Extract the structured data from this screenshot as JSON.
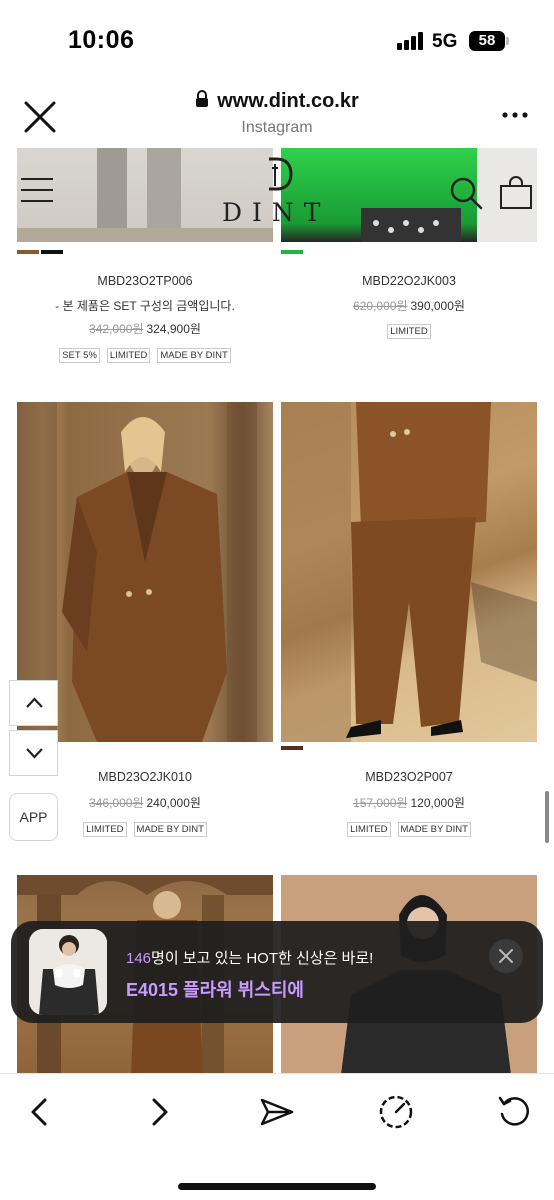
{
  "status_bar": {
    "time": "10:06",
    "network": "5G",
    "battery": "58"
  },
  "browser": {
    "url": "www.dint.co.kr",
    "source": "Instagram"
  },
  "site": {
    "logo": "DINT"
  },
  "products": [
    {
      "code": "MBD23O2TP006",
      "note": "- 본 제품은 SET 구성의 금액입니다.",
      "old_price": "342,000원",
      "price": "324,900원",
      "tags": [
        "SET 5%",
        "LIMITED",
        "MADE BY DINT"
      ],
      "swatches": [
        "#8a5a34",
        "#111111"
      ]
    },
    {
      "code": "MBD22O2JK003",
      "old_price": "620,000원",
      "price": "390,000원",
      "tags": [
        "LIMITED"
      ],
      "swatches": [
        "#1fb53e"
      ]
    },
    {
      "code": "MBD23O2JK010",
      "old_price": "346,000원",
      "price": "240,000원",
      "tags": [
        "LIMITED",
        "MADE BY DINT"
      ],
      "swatches": []
    },
    {
      "code": "MBD23O2P007",
      "old_price": "157,000원",
      "price": "120,000원",
      "tags": [
        "LIMITED",
        "MADE BY DINT"
      ],
      "swatches": [
        "#5a2e1e"
      ]
    }
  ],
  "floating": {
    "app_label": "APP"
  },
  "notification": {
    "count": "146",
    "message_rest": "명이 보고 있는 HOT한 신상은 바로!",
    "product": "E4015 플라워 뷔스티에"
  },
  "colors": {
    "accent_purple": "#c79bff",
    "toast_bg": "#1e1e1e"
  },
  "icons": [
    "close-icon",
    "lock-icon",
    "more-icon",
    "menu-icon",
    "search-icon",
    "bag-icon",
    "chevron-up-icon",
    "chevron-down-icon",
    "back-icon",
    "forward-icon",
    "share-icon",
    "speed-icon",
    "reload-icon",
    "x-icon"
  ]
}
